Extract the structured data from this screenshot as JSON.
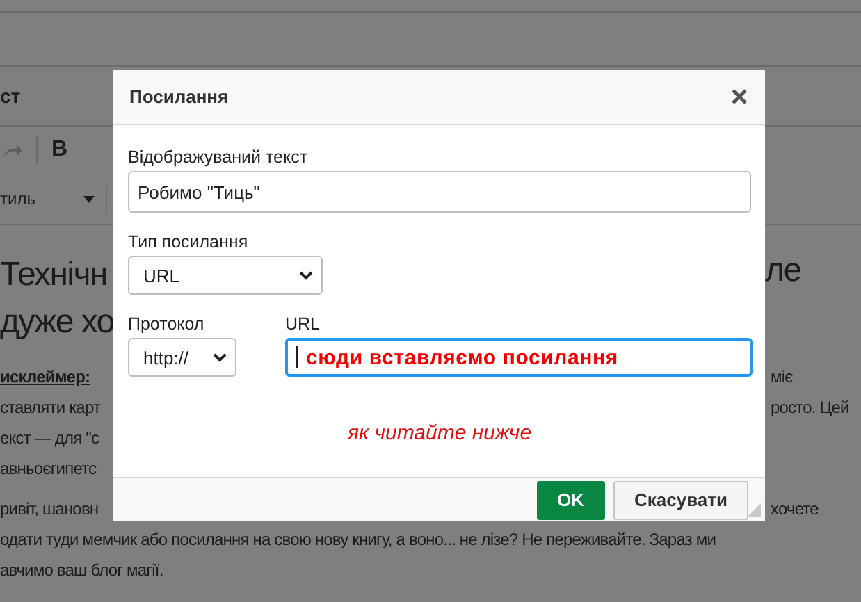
{
  "page": {
    "title_fragment": "ст",
    "bold_button": "B",
    "style_dropdown": "тиль",
    "heading": [
      {
        "left": "Технічн",
        "right": "ле"
      },
      {
        "left": "дуже хо"
      }
    ],
    "lines": [
      {
        "left": "исклеймер:",
        "right": "міє",
        "kind": "disclaimer"
      },
      {
        "left": "ставляти карт",
        "right": "росто. Цей",
        "kind": "split"
      },
      {
        "left": "екст — для \"с",
        "kind": "split"
      },
      {
        "left": "авньоєгипетс",
        "kind": "split"
      },
      {
        "left": "ривіт, шановн",
        "right": "хочете",
        "kind": "split"
      },
      {
        "left": "одати туди мемчик або посилання на свою нову книгу, а воно... не лізе? Не переживайте. Зараз ми",
        "kind": "full"
      },
      {
        "left": "авчимо ваш блог магії.",
        "kind": "full"
      }
    ]
  },
  "dialog": {
    "title": "Посилання",
    "display_text": {
      "label": "Відображуваний текст",
      "value": "Робимо \"Тиць\""
    },
    "link_type": {
      "label": "Тип посилання",
      "value": "URL"
    },
    "protocol": {
      "label": "Протокол",
      "value": "http://"
    },
    "url": {
      "label": "URL",
      "value": "сюди вставляємо посилання"
    },
    "note": "як читайте нижче",
    "buttons": [
      {
        "label": "OK",
        "kind": "primary"
      },
      {
        "label": "Скасувати",
        "kind": "secondary"
      }
    ]
  }
}
